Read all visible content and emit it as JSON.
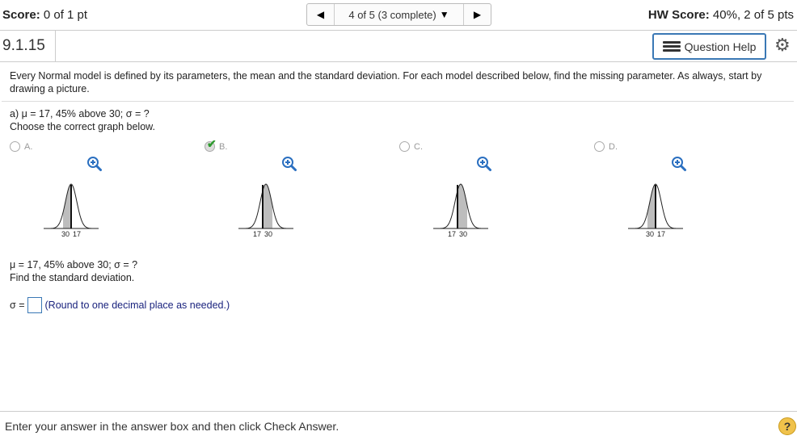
{
  "header": {
    "score_label": "Score:",
    "score_value": "0 of 1 pt",
    "nav_position": "4 of 5 (3 complete)",
    "hw_score_label": "HW Score:",
    "hw_score_value": "40%, 2 of 5 pts"
  },
  "question_bar": {
    "number": "9.1.15",
    "help_label": "Question Help"
  },
  "instructions": "Every Normal model is defined by its parameters, the mean and the standard deviation. For each model described below, find the missing parameter. As always, start by drawing a picture.",
  "part_a": {
    "prompt": "a) μ = 17, 45% above 30; σ = ?",
    "sub": "Choose the correct graph below."
  },
  "options": [
    {
      "label": "A.",
      "left_tick": "30",
      "right_tick": "17",
      "selected": false
    },
    {
      "label": "B.",
      "left_tick": "17",
      "right_tick": "30",
      "selected": true
    },
    {
      "label": "C.",
      "left_tick": "17",
      "right_tick": "30",
      "selected": false
    },
    {
      "label": "D.",
      "left_tick": "30",
      "right_tick": "17",
      "selected": false
    }
  ],
  "part_b": {
    "prompt": "μ = 17, 45% above 30; σ = ?",
    "sub": "Find the standard deviation.",
    "answer_prefix": "σ =",
    "answer_value": "",
    "hint": "(Round to one decimal place as needed.)"
  },
  "footer": {
    "text": "Enter your answer in the answer box and then click Check Answer.",
    "help_glyph": "?"
  },
  "colors": {
    "accent": "#3a78b5",
    "check": "#2e9a2e",
    "hint": "#1a237e"
  }
}
